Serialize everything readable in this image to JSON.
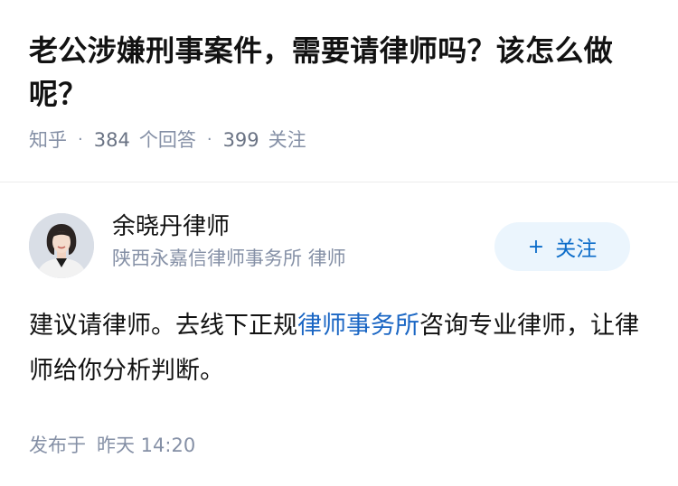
{
  "question": {
    "title": "老公涉嫌刑事案件，需要请律师吗？该怎么做呢？",
    "source": "知乎",
    "answer_count": "384",
    "answer_label": "个回答",
    "follower_count": "399",
    "follower_label": "关注"
  },
  "answer": {
    "author": {
      "name": "余晓丹律师",
      "description": "陕西永嘉信律师事务所 律师"
    },
    "follow_label": "关注",
    "body": {
      "before_link": "建议请律师。去线下正规",
      "link_text": "律师事务所",
      "after_link": "咨询专业律师，让律师给你分析判断。"
    },
    "published_prefix": "发布于",
    "published_time": "昨天 14:20"
  },
  "colors": {
    "link": "#1a66c4",
    "follow_text": "#0b6cc9",
    "follow_bg": "#ebf5fd",
    "meta_gray": "#8590a6"
  },
  "icons": {
    "follow": "plus-icon",
    "avatar": "author-avatar-photo"
  }
}
